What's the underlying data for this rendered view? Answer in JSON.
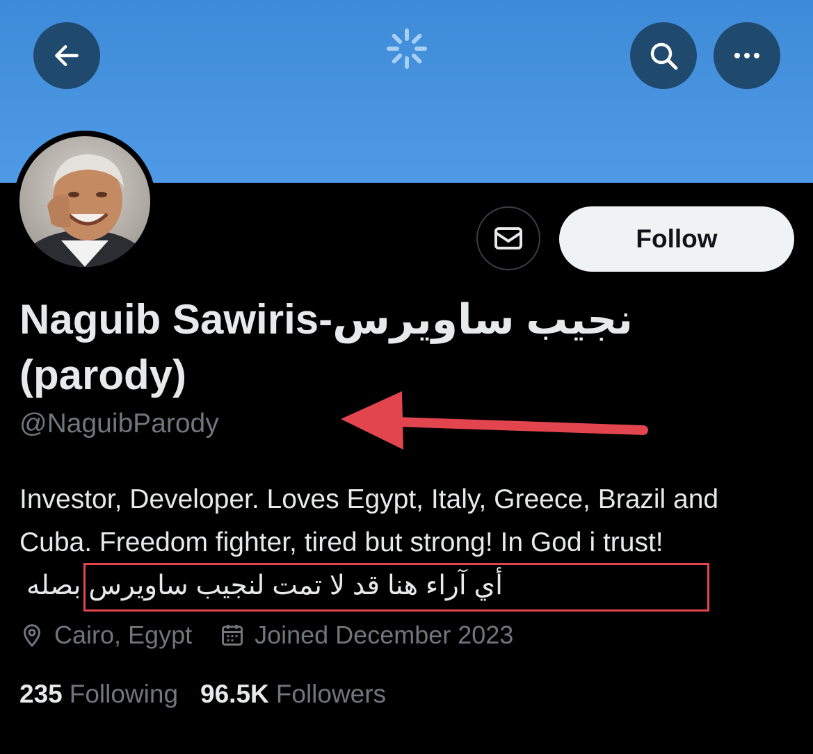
{
  "header": {
    "back_icon": "arrow-left-icon",
    "loading_icon": "spinner-icon",
    "search_icon": "search-icon",
    "more_icon": "more-horizontal-icon",
    "banner_color": "#4a96e2"
  },
  "profile": {
    "display_name": "Naguib Sawiris-نجيب ساويرس (parody)",
    "handle": "@NaguibParody",
    "follow_label": "Follow",
    "message_icon": "envelope-icon",
    "bio_en": "Investor, Developer. Loves Egypt, Italy, Greece, Brazil and Cuba. Freedom fighter, tired but strong! In God i trust!",
    "bio_ar": "أي آراء هنا قد لا تمت لنجيب ساويرس بصله",
    "location": "Cairo, Egypt",
    "joined": "Joined December 2023",
    "following_count": "235",
    "following_label": "Following",
    "followers_count": "96.5K",
    "followers_label": "Followers"
  },
  "annotations": {
    "arrow_color": "#e2454e",
    "box_color": "#e2454e"
  }
}
